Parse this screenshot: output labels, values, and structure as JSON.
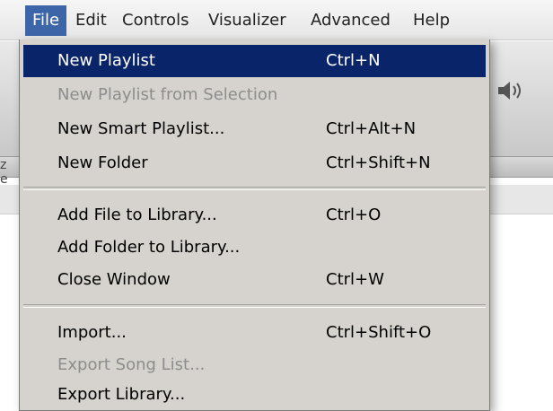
{
  "menubar": {
    "items": [
      {
        "label": "File",
        "active": true
      },
      {
        "label": "Edit"
      },
      {
        "label": "Controls"
      },
      {
        "label": "Visualizer"
      },
      {
        "label": "Advanced"
      },
      {
        "label": "Help"
      }
    ]
  },
  "file_menu": {
    "items": [
      {
        "label": "New Playlist",
        "shortcut": "Ctrl+N",
        "highlighted": true
      },
      {
        "label": "New Playlist from Selection",
        "shortcut": "",
        "disabled": true
      },
      {
        "label": "New Smart Playlist...",
        "shortcut": "Ctrl+Alt+N"
      },
      {
        "label": "New Folder",
        "shortcut": "Ctrl+Shift+N"
      },
      {
        "label": "Add File to Library...",
        "shortcut": "Ctrl+O"
      },
      {
        "label": "Add Folder to Library...",
        "shortcut": ""
      },
      {
        "label": "Close Window",
        "shortcut": "Ctrl+W"
      },
      {
        "label": "Import...",
        "shortcut": "Ctrl+Shift+O"
      },
      {
        "label": "Export Song List...",
        "shortcut": "",
        "disabled": true
      },
      {
        "label": "Export Library...",
        "shortcut": ""
      }
    ]
  },
  "colors": {
    "menu_bg": "#d6d3ce",
    "highlight": "#0a246a",
    "active_menu": "#3d66a8",
    "disabled_text": "#8d8d8d"
  },
  "icons": {
    "volume": "speaker-icon"
  }
}
